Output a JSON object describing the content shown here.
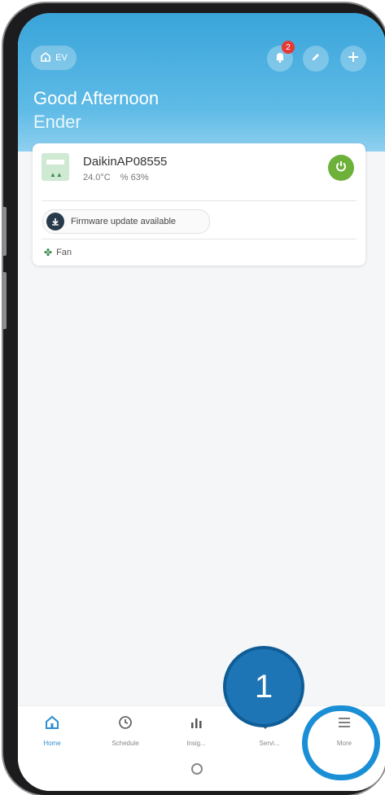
{
  "header": {
    "home_label": "EV",
    "notifications_count": "2",
    "greeting": "Good Afternoon",
    "user_name": "Ender"
  },
  "device": {
    "name": "DaikinAP08555",
    "temperature": "24.0°C",
    "humidity": "63%",
    "firmware_notice": "Firmware update available",
    "mode": "Fan",
    "power_color": "#6db13b"
  },
  "tabs": [
    {
      "label": "Home",
      "icon": "home-icon",
      "active": true
    },
    {
      "label": "Schedule",
      "icon": "clock-icon"
    },
    {
      "label": "Insig...",
      "icon": "bar-chart-icon"
    },
    {
      "label": "Servi...",
      "icon": "wrench-icon"
    },
    {
      "label": "More",
      "icon": "menu-icon"
    }
  ],
  "annotation": {
    "step_number": "1",
    "accent": "#1a8fd6"
  }
}
